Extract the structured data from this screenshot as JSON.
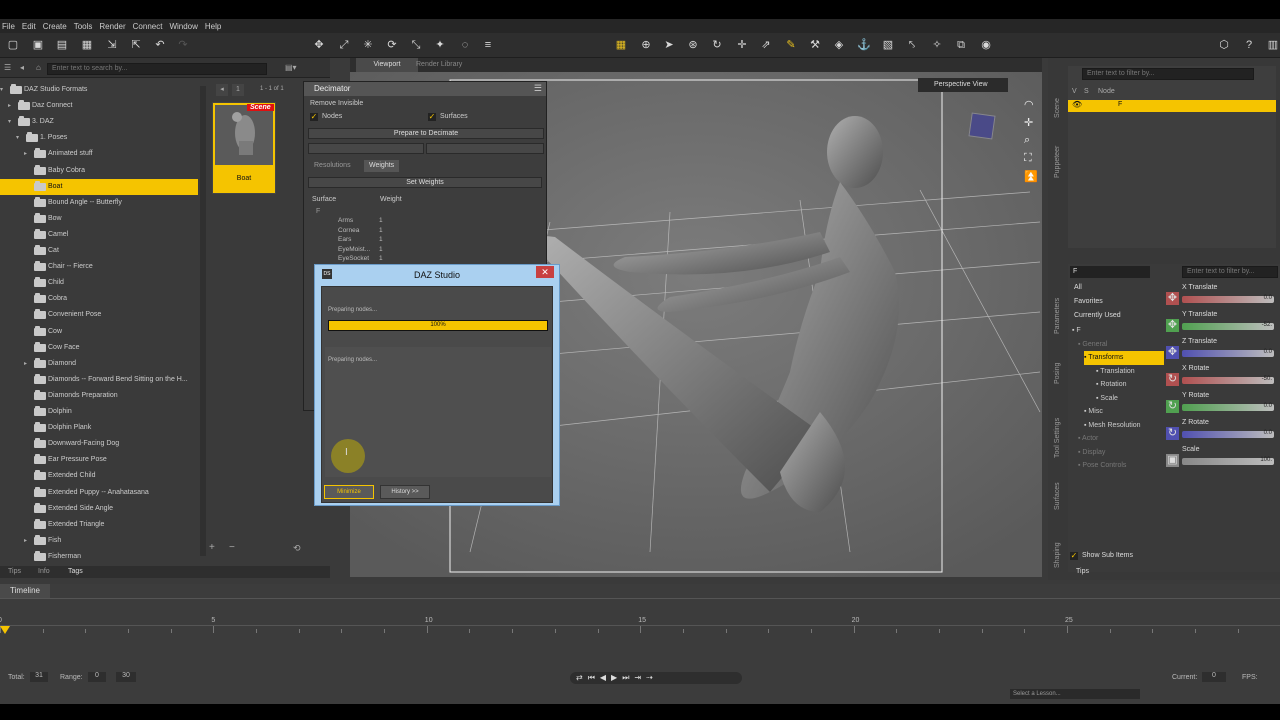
{
  "menu": [
    "File",
    "Edit",
    "Create",
    "Tools",
    "Render",
    "Connect",
    "Window",
    "Help"
  ],
  "left_panel": {
    "search_placeholder": "Enter text to search by...",
    "page_info": "1 - 1 of 1",
    "tree": [
      {
        "label": "DAZ Studio Formats",
        "depth": 0,
        "expanded": true
      },
      {
        "label": "Daz Connect",
        "depth": 1,
        "expanded": false
      },
      {
        "label": "3. DAZ",
        "depth": 1,
        "expanded": true
      },
      {
        "label": "1. Poses",
        "depth": 2,
        "expanded": true
      },
      {
        "label": "Animated stuff",
        "depth": 3,
        "expanded": false
      },
      {
        "label": "Baby Cobra",
        "depth": 3
      },
      {
        "label": "Boat",
        "depth": 3,
        "selected": true
      },
      {
        "label": "Bound Angle -- Butterfly",
        "depth": 3
      },
      {
        "label": "Bow",
        "depth": 3
      },
      {
        "label": "Camel",
        "depth": 3
      },
      {
        "label": "Cat",
        "depth": 3
      },
      {
        "label": "Chair -- Fierce",
        "depth": 3
      },
      {
        "label": "Child",
        "depth": 3
      },
      {
        "label": "Cobra",
        "depth": 3
      },
      {
        "label": "Convenient Pose",
        "depth": 3
      },
      {
        "label": "Cow",
        "depth": 3
      },
      {
        "label": "Cow Face",
        "depth": 3
      },
      {
        "label": "Diamond",
        "depth": 3,
        "expanded": false
      },
      {
        "label": "Diamonds -- Forward Bend Sitting on the H...",
        "depth": 3
      },
      {
        "label": "Diamonds Preparation",
        "depth": 3
      },
      {
        "label": "Dolphin",
        "depth": 3
      },
      {
        "label": "Dolphin Plank",
        "depth": 3
      },
      {
        "label": "Downward-Facing Dog",
        "depth": 3
      },
      {
        "label": "Ear Pressure Pose",
        "depth": 3
      },
      {
        "label": "Extended Child",
        "depth": 3
      },
      {
        "label": "Extended Puppy -- Anahatasana",
        "depth": 3
      },
      {
        "label": "Extended Side Angle",
        "depth": 3
      },
      {
        "label": "Extended Triangle",
        "depth": 3
      },
      {
        "label": "Fish",
        "depth": 3,
        "expanded": false
      },
      {
        "label": "Fisherman",
        "depth": 3
      }
    ],
    "thumb": {
      "label": "Boat",
      "badge": "Scene"
    },
    "bottom_tabs": [
      "Tips",
      "Info",
      "Tags"
    ]
  },
  "decimator": {
    "title": "Decimator",
    "remove_invisible": "Remove Invisible",
    "nodes_label": "Nodes",
    "surfaces_label": "Surfaces",
    "prepare_button": "Prepare to Decimate",
    "tabs": [
      "Resolutions",
      "Weights"
    ],
    "set_weights_button": "Set Weights",
    "columns": [
      "Surface",
      "Weight"
    ],
    "root": "F",
    "rows": [
      {
        "surface": "Arms",
        "weight": "1"
      },
      {
        "surface": "Cornea",
        "weight": "1"
      },
      {
        "surface": "Ears",
        "weight": "1"
      },
      {
        "surface": "EyeMoist...",
        "weight": "1"
      },
      {
        "surface": "EyeSocket",
        "weight": "1"
      }
    ]
  },
  "viewport": {
    "tabs": [
      "Viewport",
      "Render Library"
    ],
    "camera": "Perspective View"
  },
  "dialog": {
    "title": "DAZ Studio",
    "status_top": "Preparing nodes...",
    "progress": 100,
    "progress_label": "100%",
    "status_log": "Preparing nodes...",
    "minimize_button": "Minimize",
    "history_button": "History >>"
  },
  "scene": {
    "filter_placeholder": "Enter text to filter by...",
    "col_v": "V",
    "col_s": "S",
    "col_node": "Node",
    "selected_node": "F",
    "tabs": [
      "Scene",
      "Puppeteer"
    ]
  },
  "parameters": {
    "node": "F",
    "filter_placeholder": "Enter text to filter by...",
    "categories": [
      "All",
      "Favorites",
      "Currently Used"
    ],
    "tree": [
      {
        "label": "F",
        "depth": 0
      },
      {
        "label": "General",
        "depth": 1
      },
      {
        "label": "Transforms",
        "depth": 2,
        "selected": true
      },
      {
        "label": "Translation",
        "depth": 3
      },
      {
        "label": "Rotation",
        "depth": 3
      },
      {
        "label": "Scale",
        "depth": 3
      },
      {
        "label": "Misc",
        "depth": 2
      },
      {
        "label": "Mesh Resolution",
        "depth": 2
      },
      {
        "label": "Actor",
        "depth": 1
      },
      {
        "label": "Display",
        "depth": 1
      },
      {
        "label": "Pose Controls",
        "depth": 1
      }
    ],
    "show_sub_items": "Show Sub Items",
    "sliders": [
      {
        "label": "X Translate",
        "value": "0.0",
        "color": "#b05050"
      },
      {
        "label": "Y Translate",
        "value": "-52.",
        "color": "#50a050"
      },
      {
        "label": "Z Translate",
        "value": "0.0",
        "color": "#5050b0"
      },
      {
        "label": "X Rotate",
        "value": "-50.",
        "color": "#b05050"
      },
      {
        "label": "Y Rotate",
        "value": "0.0",
        "color": "#50a050"
      },
      {
        "label": "Z Rotate",
        "value": "0.0",
        "color": "#5050b0"
      },
      {
        "label": "Scale",
        "value": "100.",
        "color": "#888888"
      }
    ],
    "side_tabs": [
      "Parameters",
      "Posing",
      "Tool Settings",
      "Surfaces",
      "Shaping"
    ],
    "bottom_tab": "Tips"
  },
  "timeline": {
    "title": "Timeline",
    "ticks": [
      "0",
      "5",
      "10",
      "15",
      "20",
      "25"
    ],
    "total_label": "Total:",
    "total_value": "31",
    "range_label": "Range:",
    "range_start": "0",
    "range_end": "30",
    "current_label": "Current:",
    "current_value": "0",
    "fps_label": "FPS:",
    "lesson_placeholder": "Select a Lesson..."
  }
}
